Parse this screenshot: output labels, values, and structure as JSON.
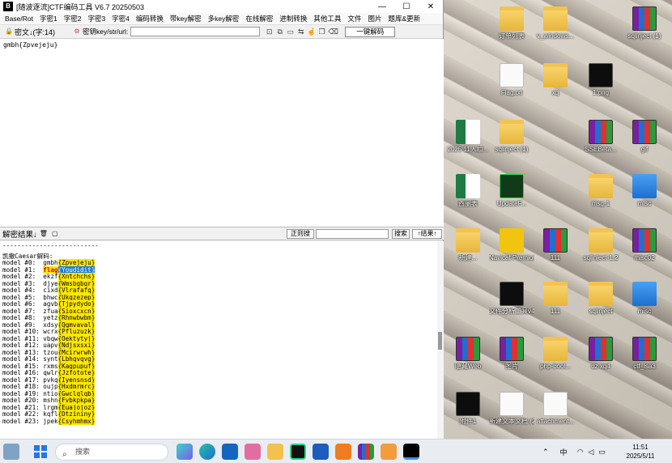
{
  "window": {
    "title": "[随波逐流]CTF编码工具 V6.7  20250503",
    "minimize": "—",
    "maximize": "☐",
    "close": "✕"
  },
  "menu": [
    "Base/Rot",
    "字密1",
    "字密2",
    "字密3",
    "字密4",
    "编码转换",
    "带key解密",
    "多key解密",
    "在线解密",
    "进制转换",
    "其他工具",
    "文件",
    "图片",
    "题库&更新"
  ],
  "toolbar": {
    "cipher_label": "密文↓(字:14)",
    "key_label": "密钥key/str/url:",
    "key_value": "",
    "decode_button": "一键解码"
  },
  "input": {
    "text": "gmbh{Zpvejeju}"
  },
  "result_bar": {
    "label": "解密结果↓",
    "regex_button": "正则搜",
    "search_button": "搜索",
    "up_button": "↑结果↑"
  },
  "output": {
    "separator": "--------------------------",
    "heading": "凯撒Caesar解码:",
    "lines": [
      {
        "prefix": "model #0:  ",
        "head": "gmbh",
        "body": "{Zpvejeju}",
        "type": "normal"
      },
      {
        "prefix": "model #1:  ",
        "head": "flag",
        "body": "{Youdidit}",
        "type": "flag"
      },
      {
        "prefix": "model #2:  ",
        "head": "ekzf",
        "body": "{Xntchchs}",
        "type": "normal"
      },
      {
        "prefix": "model #3:  ",
        "head": "djye",
        "body": "{Wmsbgbgr}",
        "type": "normal"
      },
      {
        "prefix": "model #4:  ",
        "head": "cixd",
        "body": "{Vlrafafq}",
        "type": "normal"
      },
      {
        "prefix": "model #5:  ",
        "head": "bhwc",
        "body": "{Ukqzezep}",
        "type": "normal"
      },
      {
        "prefix": "model #6:  ",
        "head": "agvb",
        "body": "{Tjpydydo}",
        "type": "normal"
      },
      {
        "prefix": "model #7:  ",
        "head": "zfua",
        "body": "{Sioxcxcn}",
        "type": "normal"
      },
      {
        "prefix": "model #8:  ",
        "head": "yetz",
        "body": "{Rhnwbwbm}",
        "type": "normal"
      },
      {
        "prefix": "model #9:  ",
        "head": "xdsy",
        "body": "{Qgmvaval}",
        "type": "normal"
      },
      {
        "prefix": "model #10: ",
        "head": "wcrx",
        "body": "{Pfluzuzk}",
        "type": "normal"
      },
      {
        "prefix": "model #11: ",
        "head": "vbqw",
        "body": "{Oektytyj}",
        "type": "normal"
      },
      {
        "prefix": "model #12: ",
        "head": "uapv",
        "body": "{Ndjsxsxi}",
        "type": "normal"
      },
      {
        "prefix": "model #13: ",
        "head": "tzou",
        "body": "{Mcirwrwh}",
        "type": "normal"
      },
      {
        "prefix": "model #14: ",
        "head": "synt",
        "body": "{Lbhqvqvg}",
        "type": "normal"
      },
      {
        "prefix": "model #15: ",
        "head": "rxms",
        "body": "{Kagpupuf}",
        "type": "normal"
      },
      {
        "prefix": "model #16: ",
        "head": "qwlr",
        "body": "{Jzfotote}",
        "type": "normal"
      },
      {
        "prefix": "model #17: ",
        "head": "pvkq",
        "body": "{Iyensnsd}",
        "type": "normal"
      },
      {
        "prefix": "model #18: ",
        "head": "oujp",
        "body": "{Hxdmrmrc}",
        "type": "normal"
      },
      {
        "prefix": "model #19: ",
        "head": "ntio",
        "body": "{Gwclqlqb}",
        "type": "normal"
      },
      {
        "prefix": "model #20: ",
        "head": "mshn",
        "body": "{Fvbkpkpa}",
        "type": "normal"
      },
      {
        "prefix": "model #21: ",
        "head": "lrgm",
        "body": "{Euajojoz}",
        "type": "normal"
      },
      {
        "prefix": "model #22: ",
        "head": "kqfl",
        "body": "{Dtzininy}",
        "type": "normal"
      },
      {
        "prefix": "model #23: ",
        "head": "jpek",
        "body": "{Csyhmhmx}",
        "type": "normal"
      }
    ]
  },
  "desktop": {
    "icons": [
      {
        "label": "订单列表",
        "kind": "folder"
      },
      {
        "label": "v_windows...",
        "kind": "folder"
      },
      {
        "label": "sqlinject (1)",
        "kind": "rar"
      },
      {
        "label": "Flag.txt",
        "kind": "file"
      },
      {
        "label": "xq",
        "kind": "folder"
      },
      {
        "label": "1.png",
        "kind": "dark"
      },
      {
        "label": "2025 11人组...",
        "kind": "excel"
      },
      {
        "label": "sqlinject (1)",
        "kind": "folder"
      },
      {
        "label": "SSEBeta...",
        "kind": "rar"
      },
      {
        "label": "gif",
        "kind": "rar"
      },
      {
        "label": "西丽表",
        "kind": "excel"
      },
      {
        "label": "UpdateF...",
        "kind": "green"
      },
      {
        "label": "msg-1",
        "kind": "folder"
      },
      {
        "label": "misc",
        "kind": "blue"
      },
      {
        "label": "新建...",
        "kind": "folder"
      },
      {
        "label": "Navicat Premium 16",
        "kind": "yellow"
      },
      {
        "label": "111",
        "kind": "rar"
      },
      {
        "label": "sqlinject-1.2",
        "kind": "folder"
      },
      {
        "label": "misc02",
        "kind": "rar"
      },
      {
        "label": "文件分析工具v4",
        "kind": "dark"
      },
      {
        "label": "111",
        "kind": "folder"
      },
      {
        "label": "sqlinject",
        "kind": "folder"
      },
      {
        "label": "misc",
        "kind": "blue"
      },
      {
        "label": "隐藏Web",
        "kind": "rar"
      },
      {
        "label": "图片",
        "kind": "rar"
      },
      {
        "label": "php-bool...",
        "kind": "folder"
      },
      {
        "label": "dz xq4",
        "kind": "rar"
      },
      {
        "label": "ctf_lsa3",
        "kind": "rar"
      },
      {
        "label": "附件1",
        "kind": "dark"
      },
      {
        "label": "新建文本文档 (2)",
        "kind": "file"
      },
      {
        "label": "attachment...",
        "kind": "file"
      }
    ]
  },
  "taskbar": {
    "search_placeholder": "搜索",
    "ime": "中",
    "time": "11:51",
    "date": "2025/5/11"
  }
}
